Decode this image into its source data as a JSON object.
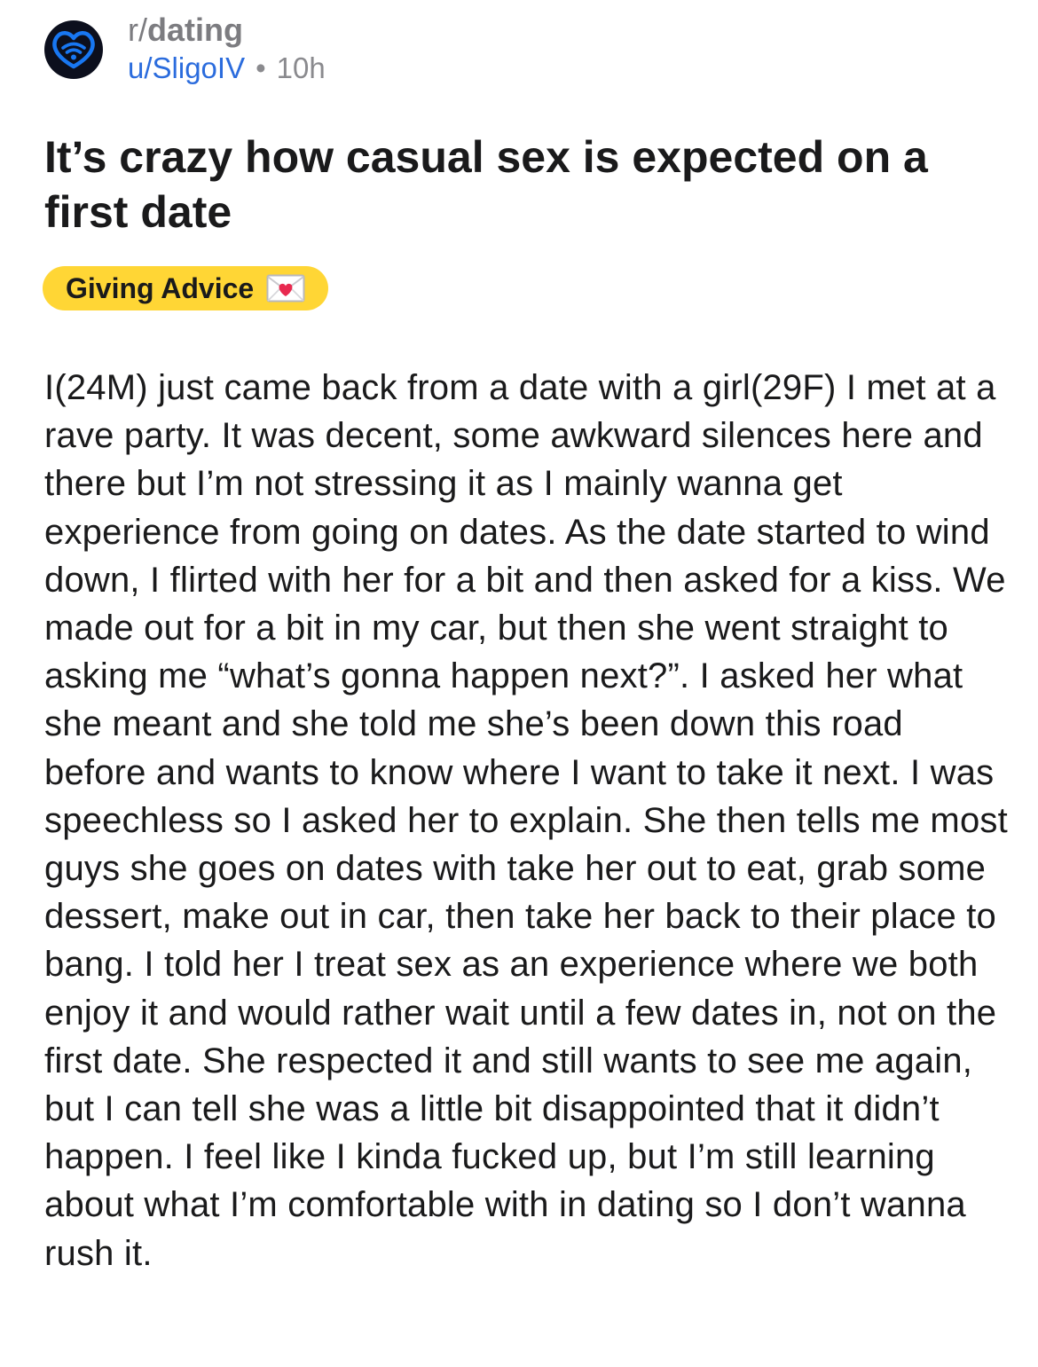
{
  "post": {
    "subreddit_prefix": "r/",
    "subreddit_name": "dating",
    "username": "u/SligoIV",
    "separator": "•",
    "age": "10h",
    "title": "It’s crazy how casual sex is expected on a first date",
    "flair": {
      "label": "Giving Advice",
      "icon": "love-letter-icon",
      "color": "#ffd635"
    },
    "body": "I(24M) just came back from a date with a girl(29F) I met at a rave party. It was decent, some awkward silences here and there but I’m not stressing it as I mainly wanna get experience from going on dates. As the date started to wind down, I flirted with her for a bit and then asked for a kiss. We made out for a bit in my car, but then she went straight to asking me “what’s gonna happen next?”. I asked her what she meant and she told me she’s been down this road before and wants to know where I want to take it next. I was speechless so I asked her to explain. She then tells me most guys she goes on dates with take her out to eat, grab some dessert, make out in car, then take her back to their place to bang. I told her I treat sex as an experience where we both enjoy it and would rather wait until a few dates in, not on the first date. She respected it and still wants to see me again, but I can tell she was a little bit disappointed that it didn’t happen. I feel like I kinda fucked up, but I’m still learning about what I’m comfortable with in dating so I don’t wanna rush it."
  },
  "colors": {
    "username": "#2b6cdd",
    "avatar_ring": "#1877f2",
    "avatar_bg": "#0c0f1d",
    "text": "#1a1a1b",
    "muted": "#8a8a8e"
  },
  "icons": {
    "avatar": "heart-wifi-icon"
  }
}
